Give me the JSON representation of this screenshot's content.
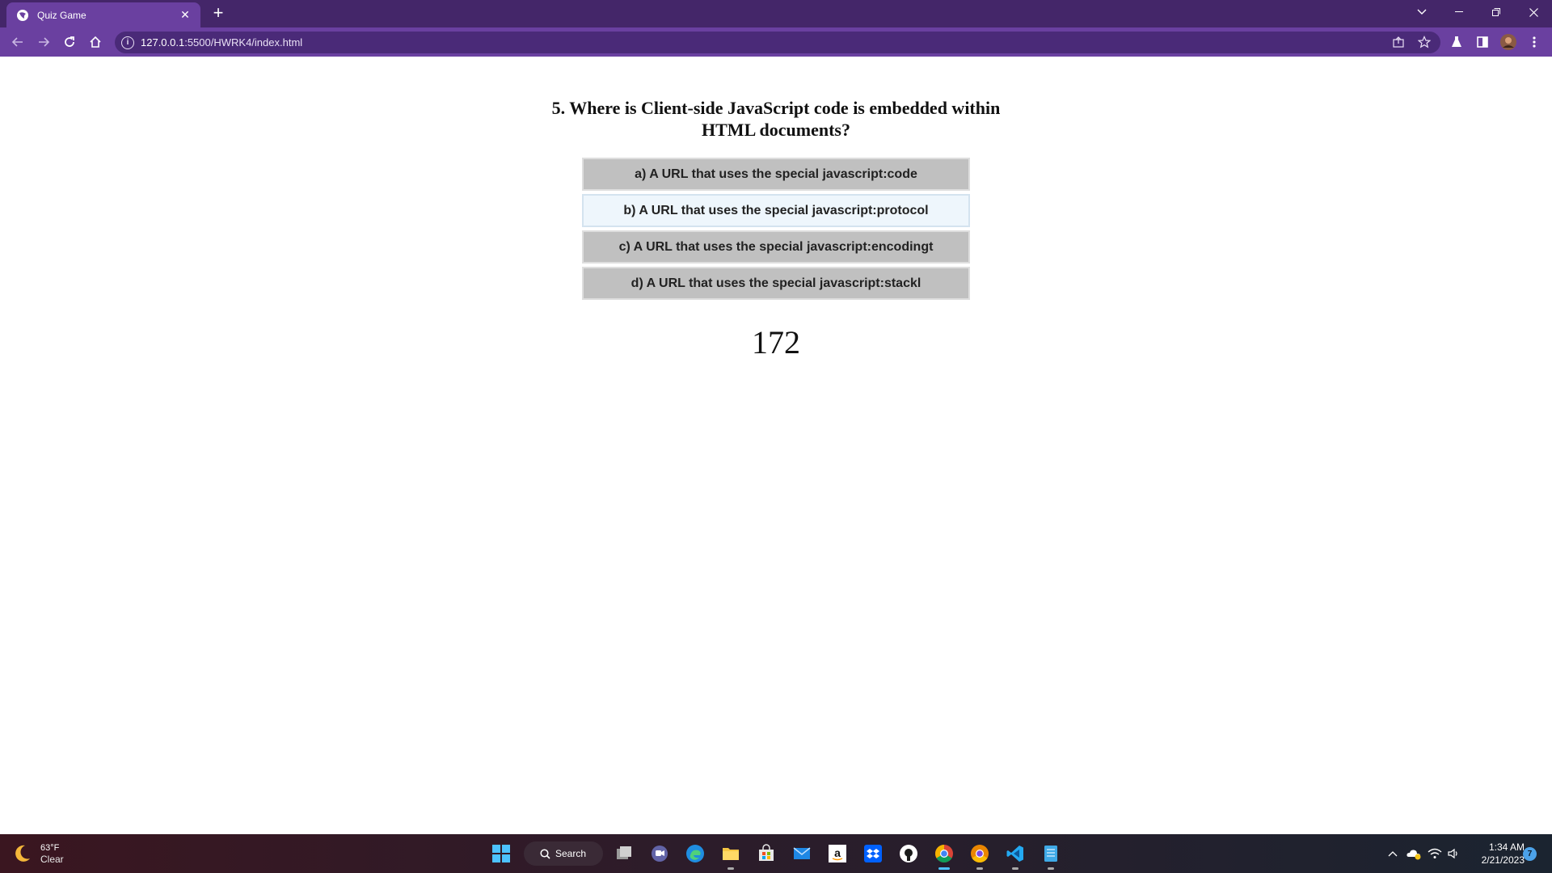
{
  "browser": {
    "tab_title": "Quiz Game",
    "url_host": "127.0.0.1",
    "url_rest": ":5500/HWRK4/index.html",
    "accent_color": "#6a40a0",
    "frame_color": "#442669"
  },
  "quiz": {
    "question": "5. Where is Client-side JavaScript code is embedded within HTML documents?",
    "answers": [
      "a) A URL that uses the special javascript:code",
      "b) A URL that uses the special javascript:protocol",
      "c) A URL that uses the special javascript:encodingt",
      "d) A URL that uses the special javascript:stackl"
    ],
    "timer": "172",
    "answer_bg": "#c0c0c0",
    "answer_hover_bg": "#eef6fc"
  },
  "taskbar": {
    "temperature": "63°F",
    "condition": "Clear",
    "search_label": "Search",
    "time": "1:34 AM",
    "date": "2/21/2023",
    "notifications": "7",
    "icons": [
      "start-icon",
      "search-icon",
      "task-view-icon",
      "teams-chat-icon",
      "edge-icon",
      "file-explorer-icon",
      "store-icon",
      "mail-icon",
      "amazon-icon",
      "dropbox-icon",
      "github-icon",
      "chrome-icon",
      "chrome-canary-icon",
      "vscode-icon",
      "notepad-icon"
    ]
  }
}
